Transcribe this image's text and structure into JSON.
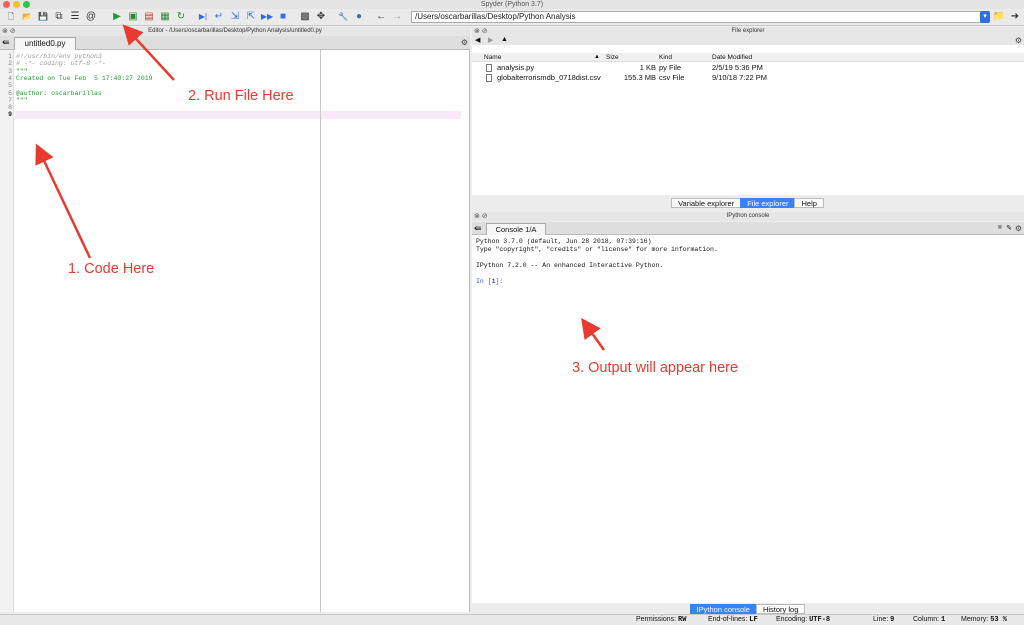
{
  "window": {
    "title": "Spyder (Python 3.7)"
  },
  "toolbar": {
    "buttons": [
      {
        "name": "new-file-icon",
        "glyph": "🗋",
        "color": "#444"
      },
      {
        "name": "open-file-icon",
        "glyph": "📂",
        "color": "#444"
      },
      {
        "name": "save-file-icon",
        "glyph": "💾",
        "color": "#444"
      },
      {
        "name": "save-all-icon",
        "glyph": "⧉",
        "color": "#444"
      },
      {
        "name": "list-icon",
        "glyph": "☰",
        "color": "#333"
      },
      {
        "name": "at-icon",
        "glyph": "@",
        "color": "#333"
      },
      {
        "name": "run-file-icon",
        "glyph": "▶",
        "color": "#1f9d2f"
      },
      {
        "name": "run-cell-icon",
        "glyph": "▣",
        "color": "#2c8a2c"
      },
      {
        "name": "run-cell-advance-icon",
        "glyph": "▤",
        "color": "#c23a2a"
      },
      {
        "name": "run-selection-icon",
        "glyph": "▦",
        "color": "#2c8a2c"
      },
      {
        "name": "rerun-icon",
        "glyph": "↻",
        "color": "#2c8a2c"
      },
      {
        "name": "debug-icon",
        "glyph": "▶|",
        "color": "#2f6ee3"
      },
      {
        "name": "step-icon",
        "glyph": "↵",
        "color": "#2f6ee3"
      },
      {
        "name": "step-into-icon",
        "glyph": "⇲",
        "color": "#2f6ee3"
      },
      {
        "name": "step-return-icon",
        "glyph": "⇱",
        "color": "#2f6ee3"
      },
      {
        "name": "continue-icon",
        "glyph": "▶▶",
        "color": "#2f6ee3"
      },
      {
        "name": "stop-debug-icon",
        "glyph": "■",
        "color": "#2f6ee3"
      },
      {
        "name": "maximize-pane-icon",
        "glyph": "▩",
        "color": "#333"
      },
      {
        "name": "fullscreen-icon",
        "glyph": "✥",
        "color": "#333"
      },
      {
        "name": "wrench-icon",
        "glyph": "🔧",
        "color": "#555"
      },
      {
        "name": "python-path-icon",
        "glyph": "●",
        "color": "#3776ab"
      },
      {
        "name": "back-arrow-icon",
        "glyph": "←",
        "color": "#333"
      },
      {
        "name": "forward-arrow-icon",
        "glyph": "→",
        "color": "#999"
      }
    ],
    "path_value": "/Users/oscarbarillas/Desktop/Python Analysis",
    "folder_icon": "folder-icon"
  },
  "editor": {
    "title": "Editor - /Users/oscarbarillas/Desktop/Python Analysis/untitled0.py",
    "tab": "untitled0.py",
    "lines": [
      {
        "n": "1",
        "text": "#!/usr/bin/env python3",
        "color": "#9a9a9a",
        "italic": true
      },
      {
        "n": "2",
        "text": "# -*- coding: utf-8 -*-",
        "color": "#9a9a9a",
        "italic": true
      },
      {
        "n": "3",
        "text": "\"\"\"",
        "color": "#1f9d2f",
        "italic": false
      },
      {
        "n": "4",
        "text": "Created on Tue Feb  5 17:40:27 2019",
        "color": "#1f9d2f",
        "italic": false
      },
      {
        "n": "5",
        "text": "",
        "color": "#1f9d2f",
        "italic": false
      },
      {
        "n": "6",
        "text": "@author: oscarbarillas",
        "color": "#1f9d2f",
        "italic": false
      },
      {
        "n": "7",
        "text": "\"\"\"",
        "color": "#1f9d2f",
        "italic": false
      },
      {
        "n": "8",
        "text": "",
        "color": "#111",
        "italic": false
      },
      {
        "n": "9",
        "text": "",
        "color": "#111",
        "italic": false
      }
    ]
  },
  "file_explorer": {
    "title": "File explorer",
    "columns": [
      "Name",
      "Size",
      "Kind",
      "Date Modified"
    ],
    "rows": [
      {
        "name": "analysis.py",
        "size": "1 KB",
        "kind": "py File",
        "date": "2/5/19 5:36 PM"
      },
      {
        "name": "globalterrorismdb_0718dist.csv",
        "size": "155.3 MB",
        "kind": "csv File",
        "date": "9/10/18 7:22 PM"
      }
    ],
    "tabs": [
      "Variable explorer",
      "File explorer",
      "Help"
    ],
    "active_tab": "File explorer"
  },
  "console": {
    "title": "IPython console",
    "tab": "Console 1/A",
    "lines": [
      "Python 3.7.0 (default, Jun 28 2018, 07:39:16)",
      "Type \"copyright\", \"credits\" or \"license\" for more information.",
      "",
      "IPython 7.2.0 -- An enhanced Interactive Python.",
      ""
    ],
    "prompt_in": "In [",
    "prompt_num": "1",
    "prompt_end": "]:",
    "tabs": [
      "IPython console",
      "History log"
    ],
    "active_tab": "IPython console"
  },
  "status": {
    "permissions_label": "Permissions:",
    "permissions": "RW",
    "eol_label": "End-of-lines:",
    "eol": "LF",
    "encoding_label": "Encoding:",
    "encoding": "UTF-8",
    "line_label": "Line:",
    "line": "9",
    "column_label": "Column:",
    "column": "1",
    "memory_label": "Memory:",
    "memory": "53 %"
  },
  "annotations": {
    "code_here": "1. Code Here",
    "run_file": "2. Run File Here",
    "output": "3. Output will appear here",
    "color": "#e83a2e"
  }
}
